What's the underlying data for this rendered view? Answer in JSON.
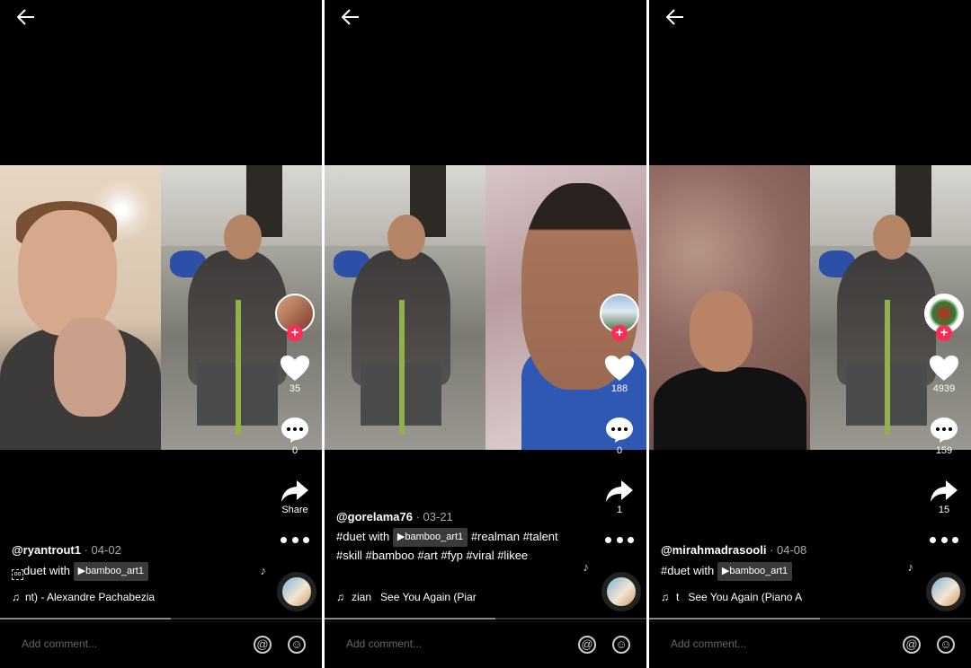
{
  "panels": [
    {
      "username": "@ryantrout1",
      "date": "04-02",
      "caption_prefix": "duet with",
      "caption_icon": "ooo-box-icon",
      "tag": "▶bamboo_art1",
      "caption_rest": "",
      "likes": "35",
      "comments": "0",
      "share_label": "Share",
      "music": "nt) - Alexandre Pachabezia",
      "music_prefix": "",
      "comment_placeholder": "Add comment...",
      "progress": 0.53
    },
    {
      "username": "@gorelama76",
      "date": "03-21",
      "caption_prefix": "#duet with",
      "tag": "▶bamboo_art1",
      "caption_rest": "#realman #talent #skill #bamboo #art #fyp #viral #likee",
      "likes": "188",
      "comments": "0",
      "share_label": "1",
      "music_prefix": "zian",
      "music": "See You Again (Piar",
      "comment_placeholder": "Add comment...",
      "progress": 0.53
    },
    {
      "username": "@mirahmadrasooli",
      "date": "04-08",
      "caption_prefix": "#duet with",
      "tag": "▶bamboo_art1",
      "caption_rest": "",
      "likes": "4939",
      "comments": "159",
      "share_label": "15",
      "music_prefix": "t",
      "music": "See You Again (Piano A",
      "comment_placeholder": "Add comment...",
      "progress": 0.53
    }
  ],
  "icons": {
    "back": "arrow-left-icon",
    "heart": "heart-icon",
    "comment": "comment-bubble-icon",
    "share": "share-arrow-icon",
    "more": "more-dots-icon",
    "music": "music-note-icon",
    "mention": "at-icon",
    "emoji": "smiley-icon"
  },
  "colors": {
    "background": "#000000",
    "follow": "#fe2c55",
    "tag_bg": "#3a3a3a"
  }
}
